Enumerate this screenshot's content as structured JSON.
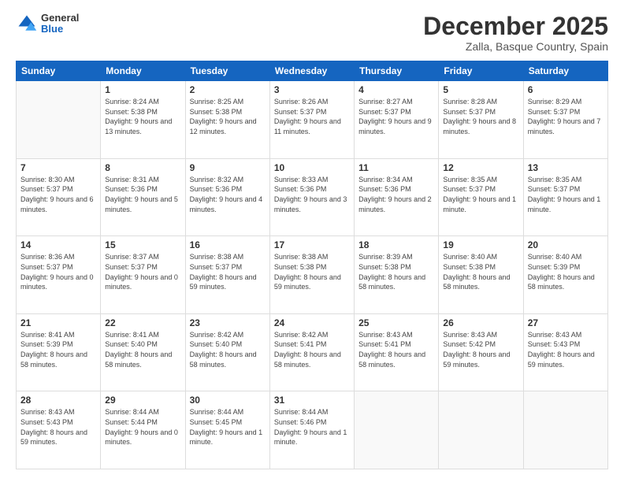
{
  "header": {
    "logo_general": "General",
    "logo_blue": "Blue",
    "month_title": "December 2025",
    "location": "Zalla, Basque Country, Spain"
  },
  "days_of_week": [
    "Sunday",
    "Monday",
    "Tuesday",
    "Wednesday",
    "Thursday",
    "Friday",
    "Saturday"
  ],
  "weeks": [
    [
      {
        "day": "",
        "sunrise": "",
        "sunset": "",
        "daylight": ""
      },
      {
        "day": "1",
        "sunrise": "Sunrise: 8:24 AM",
        "sunset": "Sunset: 5:38 PM",
        "daylight": "Daylight: 9 hours and 13 minutes."
      },
      {
        "day": "2",
        "sunrise": "Sunrise: 8:25 AM",
        "sunset": "Sunset: 5:38 PM",
        "daylight": "Daylight: 9 hours and 12 minutes."
      },
      {
        "day": "3",
        "sunrise": "Sunrise: 8:26 AM",
        "sunset": "Sunset: 5:37 PM",
        "daylight": "Daylight: 9 hours and 11 minutes."
      },
      {
        "day": "4",
        "sunrise": "Sunrise: 8:27 AM",
        "sunset": "Sunset: 5:37 PM",
        "daylight": "Daylight: 9 hours and 9 minutes."
      },
      {
        "day": "5",
        "sunrise": "Sunrise: 8:28 AM",
        "sunset": "Sunset: 5:37 PM",
        "daylight": "Daylight: 9 hours and 8 minutes."
      },
      {
        "day": "6",
        "sunrise": "Sunrise: 8:29 AM",
        "sunset": "Sunset: 5:37 PM",
        "daylight": "Daylight: 9 hours and 7 minutes."
      }
    ],
    [
      {
        "day": "7",
        "sunrise": "Sunrise: 8:30 AM",
        "sunset": "Sunset: 5:37 PM",
        "daylight": "Daylight: 9 hours and 6 minutes."
      },
      {
        "day": "8",
        "sunrise": "Sunrise: 8:31 AM",
        "sunset": "Sunset: 5:36 PM",
        "daylight": "Daylight: 9 hours and 5 minutes."
      },
      {
        "day": "9",
        "sunrise": "Sunrise: 8:32 AM",
        "sunset": "Sunset: 5:36 PM",
        "daylight": "Daylight: 9 hours and 4 minutes."
      },
      {
        "day": "10",
        "sunrise": "Sunrise: 8:33 AM",
        "sunset": "Sunset: 5:36 PM",
        "daylight": "Daylight: 9 hours and 3 minutes."
      },
      {
        "day": "11",
        "sunrise": "Sunrise: 8:34 AM",
        "sunset": "Sunset: 5:36 PM",
        "daylight": "Daylight: 9 hours and 2 minutes."
      },
      {
        "day": "12",
        "sunrise": "Sunrise: 8:35 AM",
        "sunset": "Sunset: 5:37 PM",
        "daylight": "Daylight: 9 hours and 1 minute."
      },
      {
        "day": "13",
        "sunrise": "Sunrise: 8:35 AM",
        "sunset": "Sunset: 5:37 PM",
        "daylight": "Daylight: 9 hours and 1 minute."
      }
    ],
    [
      {
        "day": "14",
        "sunrise": "Sunrise: 8:36 AM",
        "sunset": "Sunset: 5:37 PM",
        "daylight": "Daylight: 9 hours and 0 minutes."
      },
      {
        "day": "15",
        "sunrise": "Sunrise: 8:37 AM",
        "sunset": "Sunset: 5:37 PM",
        "daylight": "Daylight: 9 hours and 0 minutes."
      },
      {
        "day": "16",
        "sunrise": "Sunrise: 8:38 AM",
        "sunset": "Sunset: 5:37 PM",
        "daylight": "Daylight: 8 hours and 59 minutes."
      },
      {
        "day": "17",
        "sunrise": "Sunrise: 8:38 AM",
        "sunset": "Sunset: 5:38 PM",
        "daylight": "Daylight: 8 hours and 59 minutes."
      },
      {
        "day": "18",
        "sunrise": "Sunrise: 8:39 AM",
        "sunset": "Sunset: 5:38 PM",
        "daylight": "Daylight: 8 hours and 58 minutes."
      },
      {
        "day": "19",
        "sunrise": "Sunrise: 8:40 AM",
        "sunset": "Sunset: 5:38 PM",
        "daylight": "Daylight: 8 hours and 58 minutes."
      },
      {
        "day": "20",
        "sunrise": "Sunrise: 8:40 AM",
        "sunset": "Sunset: 5:39 PM",
        "daylight": "Daylight: 8 hours and 58 minutes."
      }
    ],
    [
      {
        "day": "21",
        "sunrise": "Sunrise: 8:41 AM",
        "sunset": "Sunset: 5:39 PM",
        "daylight": "Daylight: 8 hours and 58 minutes."
      },
      {
        "day": "22",
        "sunrise": "Sunrise: 8:41 AM",
        "sunset": "Sunset: 5:40 PM",
        "daylight": "Daylight: 8 hours and 58 minutes."
      },
      {
        "day": "23",
        "sunrise": "Sunrise: 8:42 AM",
        "sunset": "Sunset: 5:40 PM",
        "daylight": "Daylight: 8 hours and 58 minutes."
      },
      {
        "day": "24",
        "sunrise": "Sunrise: 8:42 AM",
        "sunset": "Sunset: 5:41 PM",
        "daylight": "Daylight: 8 hours and 58 minutes."
      },
      {
        "day": "25",
        "sunrise": "Sunrise: 8:43 AM",
        "sunset": "Sunset: 5:41 PM",
        "daylight": "Daylight: 8 hours and 58 minutes."
      },
      {
        "day": "26",
        "sunrise": "Sunrise: 8:43 AM",
        "sunset": "Sunset: 5:42 PM",
        "daylight": "Daylight: 8 hours and 59 minutes."
      },
      {
        "day": "27",
        "sunrise": "Sunrise: 8:43 AM",
        "sunset": "Sunset: 5:43 PM",
        "daylight": "Daylight: 8 hours and 59 minutes."
      }
    ],
    [
      {
        "day": "28",
        "sunrise": "Sunrise: 8:43 AM",
        "sunset": "Sunset: 5:43 PM",
        "daylight": "Daylight: 8 hours and 59 minutes."
      },
      {
        "day": "29",
        "sunrise": "Sunrise: 8:44 AM",
        "sunset": "Sunset: 5:44 PM",
        "daylight": "Daylight: 9 hours and 0 minutes."
      },
      {
        "day": "30",
        "sunrise": "Sunrise: 8:44 AM",
        "sunset": "Sunset: 5:45 PM",
        "daylight": "Daylight: 9 hours and 1 minute."
      },
      {
        "day": "31",
        "sunrise": "Sunrise: 8:44 AM",
        "sunset": "Sunset: 5:46 PM",
        "daylight": "Daylight: 9 hours and 1 minute."
      },
      {
        "day": "",
        "sunrise": "",
        "sunset": "",
        "daylight": ""
      },
      {
        "day": "",
        "sunrise": "",
        "sunset": "",
        "daylight": ""
      },
      {
        "day": "",
        "sunrise": "",
        "sunset": "",
        "daylight": ""
      }
    ]
  ]
}
